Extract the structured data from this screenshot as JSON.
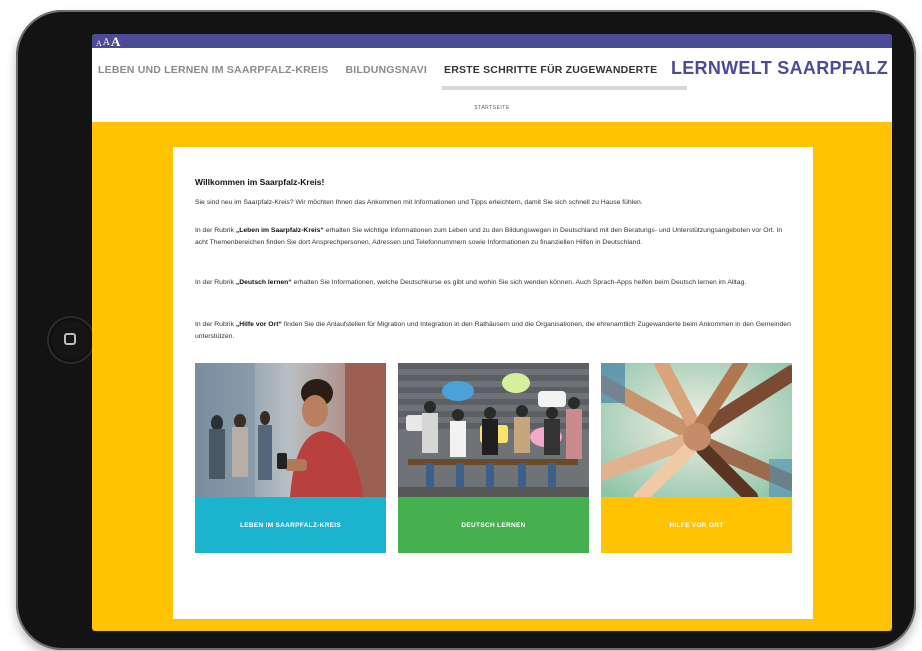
{
  "accessibility": {
    "font_sizes": [
      "A",
      "A",
      "A"
    ]
  },
  "header": {
    "nav_items": [
      "LEBEN UND LERNEN IM SAARPFALZ-KREIS",
      "BILDUNGSNAVI",
      "ERSTE SCHRITTE FÜR ZUGEWANDERTE"
    ],
    "brand": "LERNWELT SAARPFALZ"
  },
  "subnav": {
    "label": "STARTSEITE"
  },
  "main": {
    "title": "Willkommen im Saarpfalz-Kreis!",
    "intro": "Sie sind neu im Saarpfalz-Kreis? Wir möchten Ihnen das Ankommen mit Informationen und Tipps erleichtern, damit Sie sich schnell zu Hause fühlen.",
    "p2_prefix": "In der Rubrik ",
    "p2_bold": "„Leben im Saarpfalz-Kreis“",
    "p2_rest": " erhalten Sie wichtige Informationen zum Leben und zu den Bildungswegen in Deutschland mit den Beratungs- und Unterstützungsangeboten vor Ort. In acht Themenbereichen finden Sie dort Ansprechpersonen, Adressen und Telefonnummern sowie Informationen zu finanziellen Hilfen in Deutschland.",
    "p3_prefix": "In der Rubrik ",
    "p3_bold": "„Deutsch lernen“",
    "p3_rest": " erhalten Sie Informationen, welche Deutschkurse es gibt und wohin Sie sich wenden können. Auch Sprach-Apps helfen beim Deutsch lernen im Alltag.",
    "p4_prefix": "In der Rubrik ",
    "p4_bold": "„Hilfe vor Ort“",
    "p4_rest": " finden Sie die Anlaufstellen für Migration und Integration in den Rathäusern und die Organisationen, die ehrenamtlich Zugewanderte beim Ankommen in den Gemeinden unterstützen.",
    "tiles": [
      {
        "label": "LEBEN IM SAARPFALZ-KREIS",
        "color": "#1cb3cf"
      },
      {
        "label": "DEUTSCH LERNEN",
        "color": "#46b050"
      },
      {
        "label": "HILFE VOR ORT",
        "color": "#ffc304"
      }
    ]
  },
  "colors": {
    "accent": "#4b4b97",
    "page_background": "#ffc304"
  }
}
